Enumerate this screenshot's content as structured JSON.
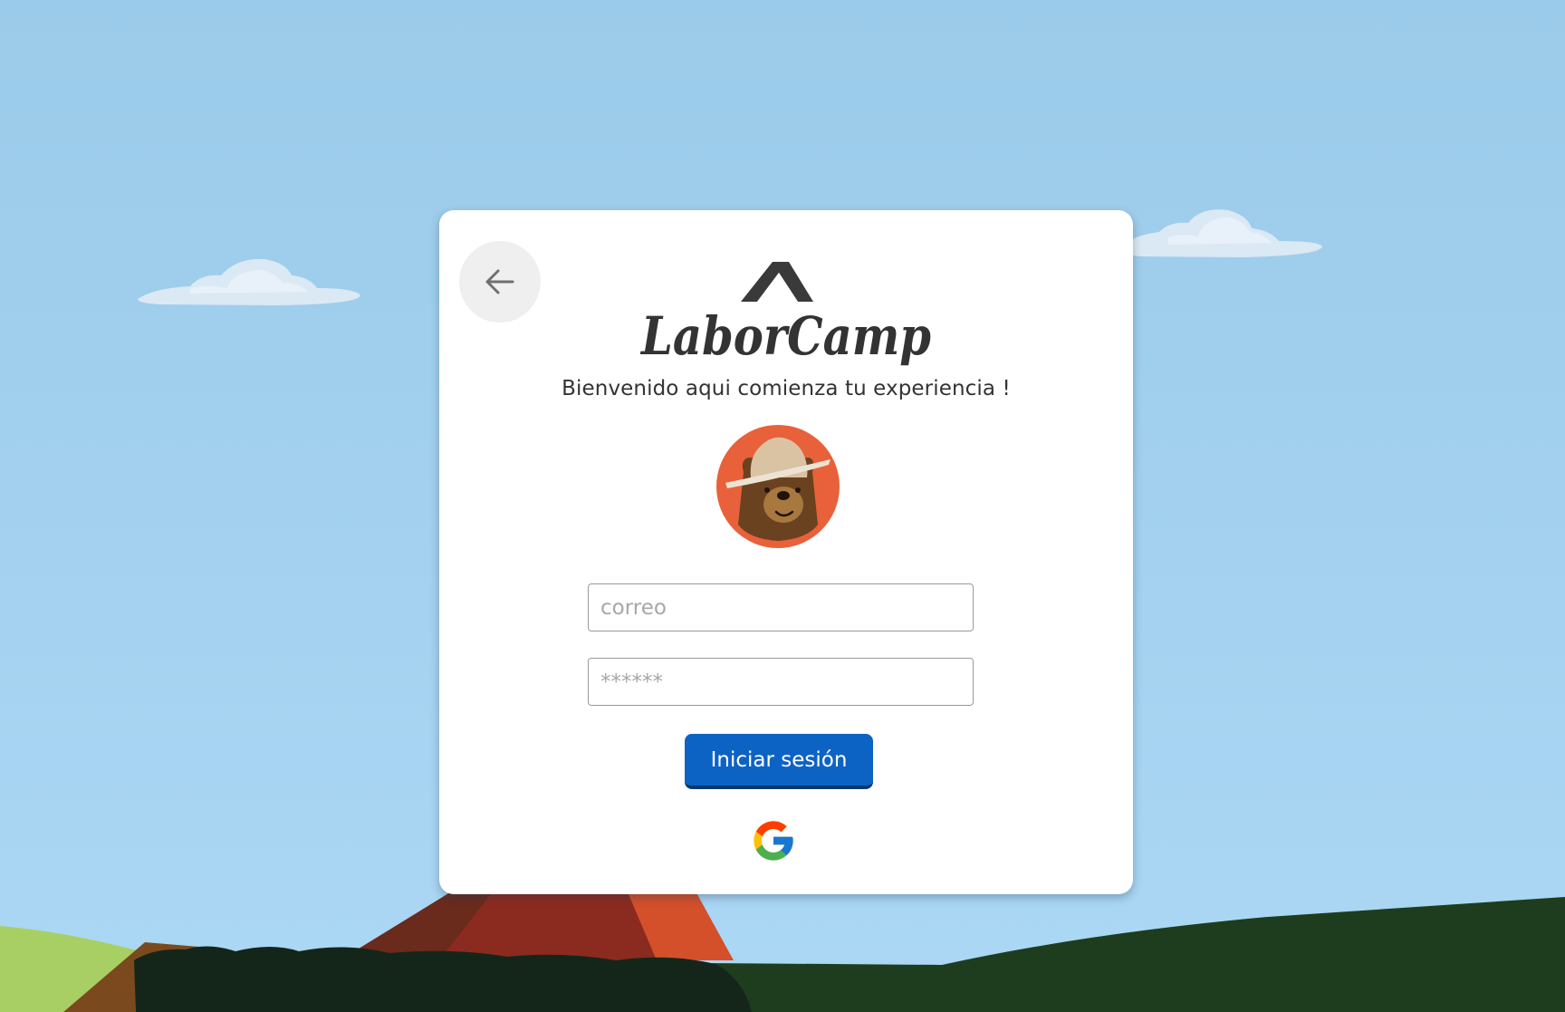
{
  "card": {
    "back_icon": "arrow-left-icon",
    "logo_text": "LaborCamp",
    "welcome_text": "Bienvenido aqui comienza tu experiencia !",
    "avatar_icon": "ranger-bear-icon"
  },
  "form": {
    "email_placeholder": "correo",
    "email_value": "",
    "password_placeholder": "******",
    "password_value": "",
    "submit_label": "Iniciar sesión",
    "google_icon": "google-icon"
  },
  "colors": {
    "sky": "#9bcbea",
    "card": "#ffffff",
    "primary_button": "#0d63c4",
    "avatar_bg": "#e8613a",
    "logo": "#333333"
  }
}
